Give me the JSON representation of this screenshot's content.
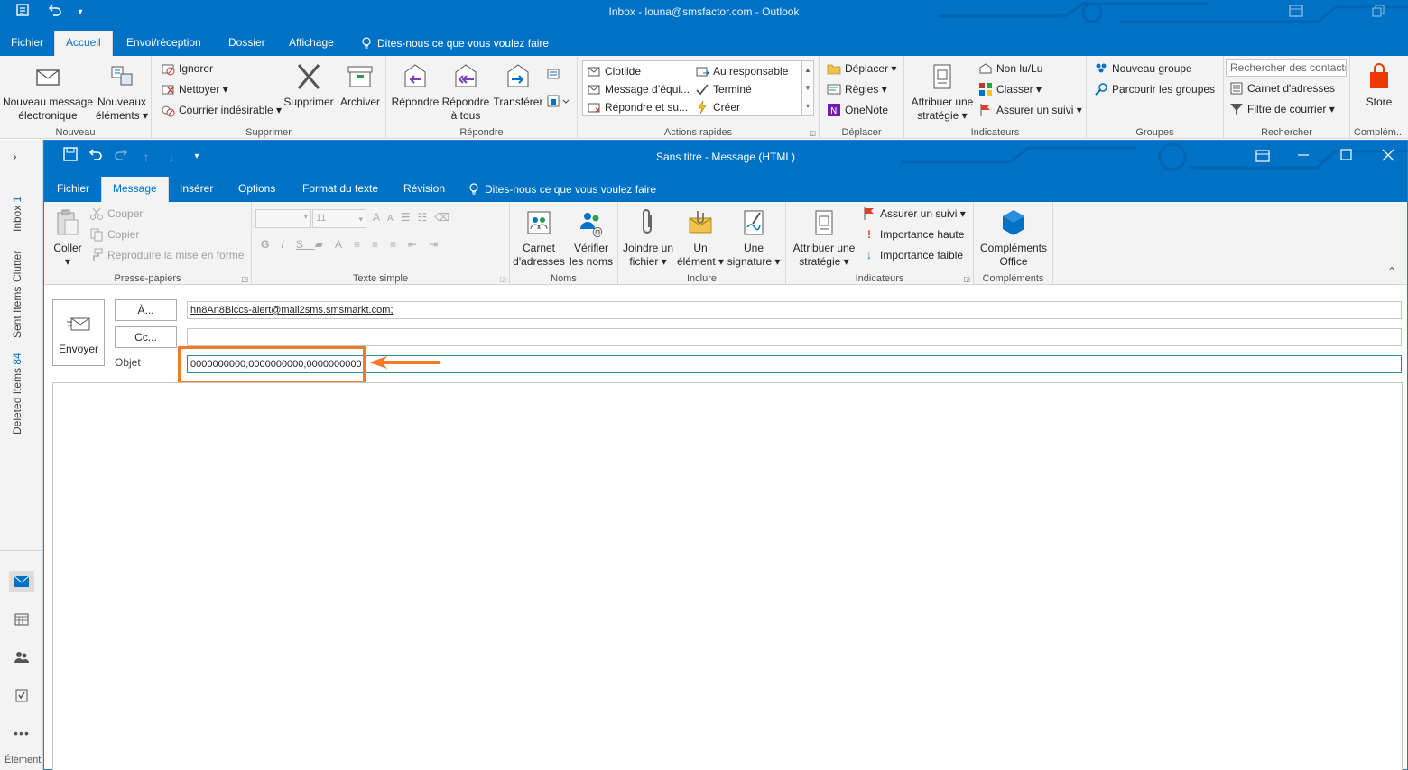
{
  "main_window": {
    "title": "Inbox - louna@smsfactor.com - Outlook",
    "tabs": [
      "Fichier",
      "Accueil",
      "Envoi/réception",
      "Dossier",
      "Affichage"
    ],
    "active_tab": "Accueil",
    "tell_me": "Dites-nous ce que vous voulez faire",
    "ribbon": {
      "nouveau": {
        "label": "Nouveau",
        "new_email": "Nouveau message électronique",
        "new_items": "Nouveaux éléments"
      },
      "supprimer": {
        "label": "Supprimer",
        "ignore": "Ignorer",
        "clean": "Nettoyer",
        "junk": "Courrier indésirable",
        "delete": "Supprimer",
        "archive": "Archiver"
      },
      "repondre": {
        "label": "Répondre",
        "reply": "Répondre",
        "reply_all": "Répondre à tous",
        "forward": "Transférer"
      },
      "quick_steps": {
        "label": "Actions rapides",
        "items": [
          "Clotilde",
          "Au responsable",
          "Message d’équi...",
          "Terminé",
          "Répondre et su...",
          "Créer"
        ]
      },
      "deplacer": {
        "label": "Déplacer",
        "move": "Déplacer",
        "rules": "Règles",
        "onenote": "OneNote"
      },
      "indicateurs": {
        "label": "Indicateurs",
        "policy": "Attribuer une stratégie",
        "unread": "Non lu/Lu",
        "categorize": "Classer",
        "followup": "Assurer un suivi"
      },
      "groupes": {
        "label": "Groupes",
        "new_group": "Nouveau groupe",
        "browse_groups": "Parcourir les groupes"
      },
      "rechercher": {
        "label": "Rechercher",
        "search_placeholder": "Rechercher des contacts",
        "address_book": "Carnet d'adresses",
        "filter": "Filtre de courrier"
      },
      "complements": {
        "label": "Complém...",
        "store": "Store"
      }
    }
  },
  "left_pane": {
    "folders": [
      {
        "name": "Inbox",
        "count": "1"
      },
      {
        "name": "Clutter",
        "count": ""
      },
      {
        "name": "Sent Items",
        "count": ""
      },
      {
        "name": "Deleted Items",
        "count": "84"
      }
    ],
    "bottom_label": "Élément"
  },
  "message_window": {
    "title": "Sans titre - Message (HTML)",
    "tabs": [
      "Fichier",
      "Message",
      "Insérer",
      "Options",
      "Format du texte",
      "Révision"
    ],
    "active_tab": "Message",
    "tell_me": "Dites-nous ce que vous voulez faire",
    "ribbon": {
      "clipboard": {
        "label": "Presse-papiers",
        "paste": "Coller",
        "cut": "Couper",
        "copy": "Copier",
        "format_painter": "Reproduire la mise en forme"
      },
      "basic_text": {
        "label": "Texte simple",
        "font_size": "11"
      },
      "names": {
        "label": "Noms",
        "address_book": "Carnet d'adresses",
        "check_names": "Vérifier les noms"
      },
      "include": {
        "label": "Inclure",
        "attach_file": "Joindre un fichier",
        "attach_item": "Un élément",
        "signature": "Une signature"
      },
      "tags": {
        "label": "Indicateurs",
        "policy": "Attribuer une stratégie",
        "followup": "Assurer un suivi",
        "high": "Importance haute",
        "low": "Importance faible"
      },
      "addins": {
        "label": "Compléments",
        "office_addins": "Compléments Office"
      }
    },
    "compose": {
      "send": "Envoyer",
      "to_button": "À...",
      "cc_button": "Cc...",
      "subject_label": "Objet",
      "to_value": "hn8An8Biccs-alert@mail2sms.smsmarkt.com;",
      "cc_value": "",
      "subject_value": "0000000000;0000000000;0000000000"
    }
  },
  "colors": {
    "accent": "#0072c6",
    "annotation": "#f07c28",
    "ribbon_bg": "#f3f3f3"
  }
}
